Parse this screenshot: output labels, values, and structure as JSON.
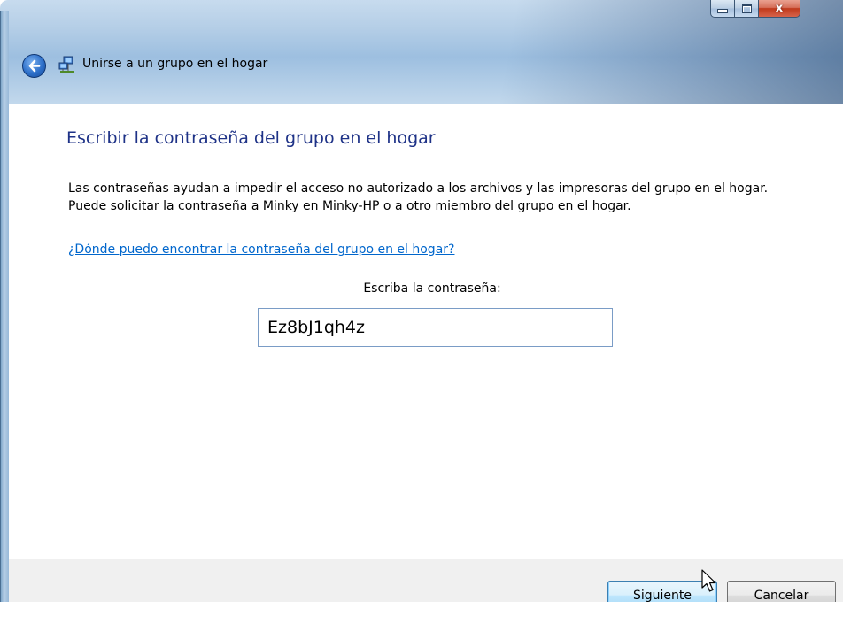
{
  "window": {
    "title": "Unirse a un grupo en el hogar",
    "caption_buttons": {
      "minimize": "minimize-icon",
      "maximize": "maximize-icon",
      "close": "x"
    }
  },
  "content": {
    "heading": "Escribir la contraseña del grupo en el hogar",
    "description": "Las contraseñas ayudan a impedir el acceso no autorizado a los archivos y las impresoras del grupo en el hogar. Puede solicitar la contraseña a Minky en Minky-HP o a otro miembro del grupo en el hogar.",
    "help_link": "¿Dónde puedo encontrar la contraseña del grupo en el hogar?",
    "password_label": "Escriba la contraseña:",
    "password_value": "Ez8bJ1qh4z"
  },
  "footer": {
    "next_label": "Siguiente",
    "cancel_label": "Cancelar"
  },
  "colors": {
    "heading": "#1e3287",
    "link": "#0066cc",
    "close_button": "#c0391b"
  }
}
